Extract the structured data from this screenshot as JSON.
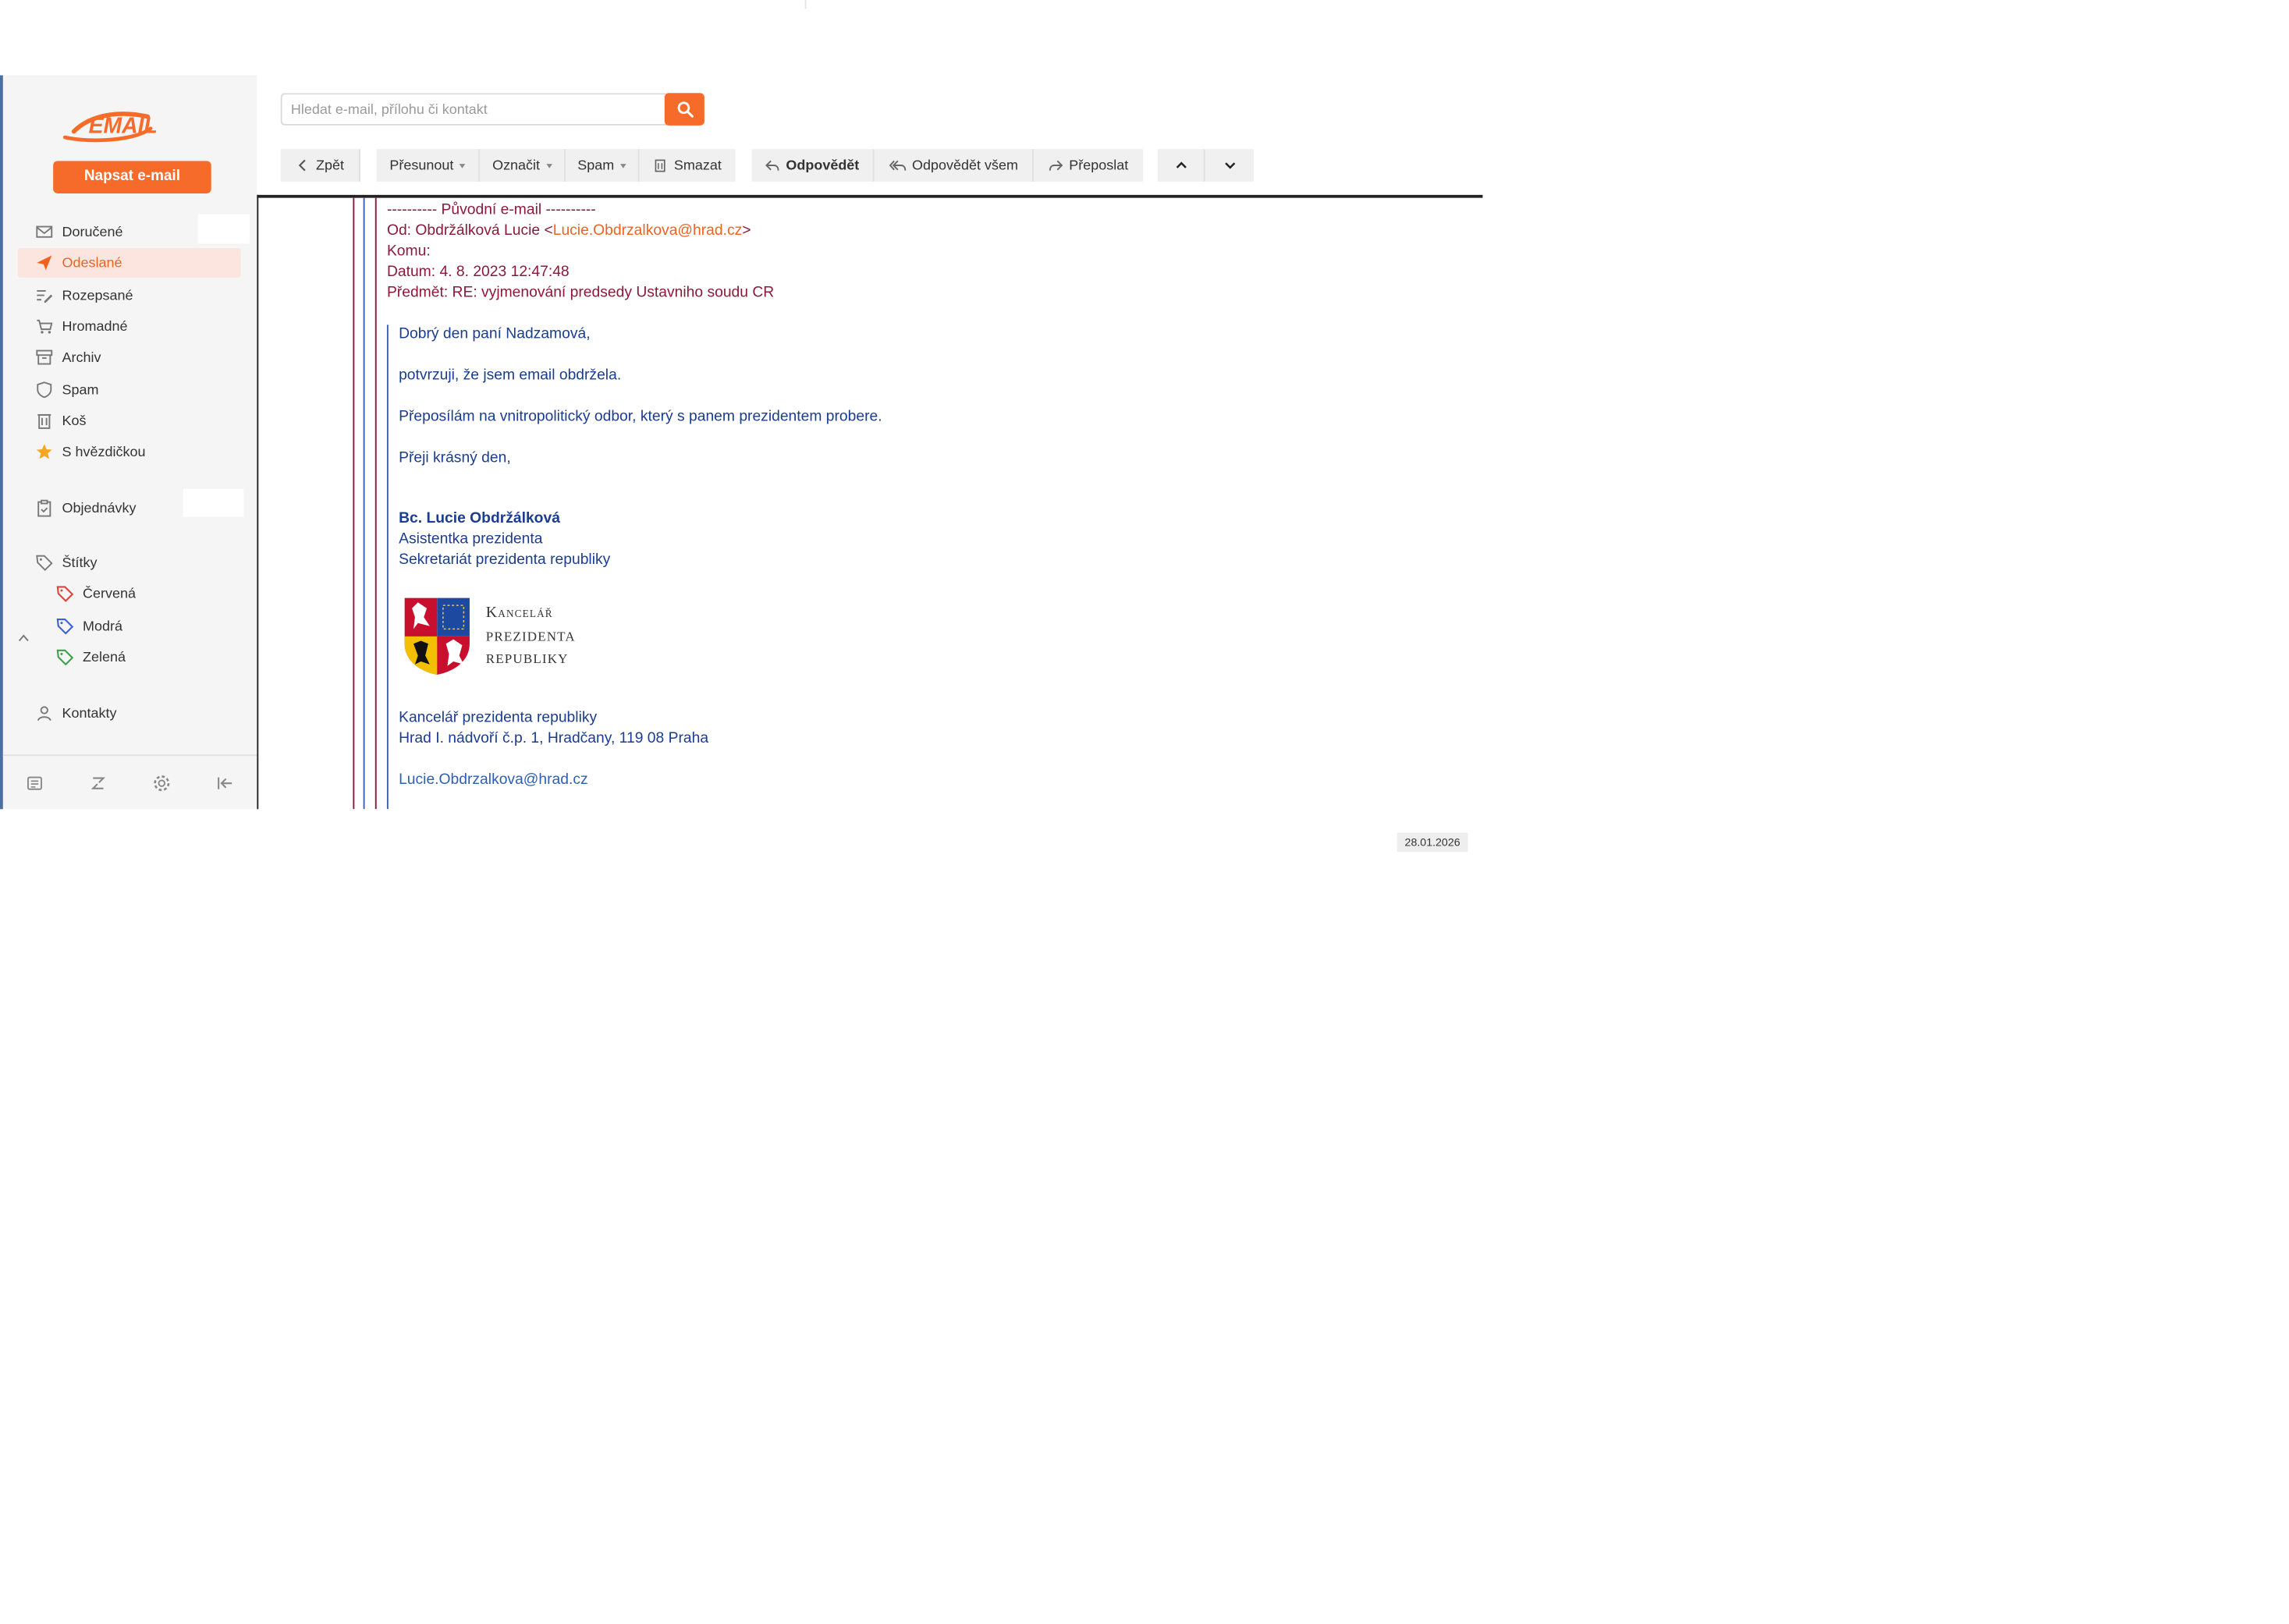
{
  "app": {
    "logo_text": "EMAIL",
    "compose_label": "Napsat e-mail",
    "accent": "#f66b2a"
  },
  "sidebar": {
    "folders": [
      {
        "label": "Doručené",
        "icon": "envelope-icon"
      },
      {
        "label": "Odeslané",
        "icon": "paper-plane-icon",
        "active": true
      },
      {
        "label": "Rozepsané",
        "icon": "draft-icon"
      },
      {
        "label": "Hromadné",
        "icon": "cart-icon"
      },
      {
        "label": "Archiv",
        "icon": "archive-icon"
      },
      {
        "label": "Spam",
        "icon": "shield-icon"
      },
      {
        "label": "Koš",
        "icon": "trash-icon"
      },
      {
        "label": "S hvězdičkou",
        "icon": "star-icon"
      }
    ],
    "orders_label": "Objednávky",
    "labels_title": "Štítky",
    "labels": [
      {
        "label": "Červená",
        "color": "#e0443b"
      },
      {
        "label": "Modrá",
        "color": "#3b5fd9"
      },
      {
        "label": "Zelená",
        "color": "#3aa04a"
      }
    ],
    "contacts_label": "Kontakty"
  },
  "search": {
    "placeholder": "Hledat e-mail, přílohu či kontakt",
    "value": ""
  },
  "toolbar": {
    "back": "Zpět",
    "move": "Přesunout",
    "mark": "Označit",
    "spam": "Spam",
    "delete": "Smazat",
    "reply": "Odpovědět",
    "reply_all": "Odpovědět všem",
    "forward": "Přeposlat"
  },
  "message": {
    "separator": "---------- Původní e-mail ----------",
    "from_prefix": "Od: Obdržálková Lucie <",
    "from_email": "Lucie.Obdrzalkova@hrad.cz",
    "from_suffix": ">",
    "to": "Komu:",
    "date": "Datum: 4. 8. 2023 12:47:48",
    "subject": "Předmět: RE: vyjmenování predsedy Ustavniho soudu CR",
    "greeting": "Dobrý den paní Nadzamová,",
    "line1": "potvrzuji, že jsem email obdržela.",
    "line2": "Přeposílám na vnitropolitický odbor, který s panem prezidentem probere.",
    "closing": "Přeji krásný den,",
    "sig_name": "Bc. Lucie Obdržálková",
    "sig_title": "Asistentka prezidenta",
    "sig_dept": "Sekretariát prezidenta republiky",
    "logo_line1": "Kancelář",
    "logo_line2": "prezidenta",
    "logo_line3": "republiky",
    "org": "Kancelář prezidenta republiky",
    "address": "Hrad I. nádvoří č.p. 1, Hradčany, 119 08  Praha",
    "sig_email": "Lucie.Obdrzalkova@hrad.cz"
  },
  "date_badge": "28.01.2026"
}
